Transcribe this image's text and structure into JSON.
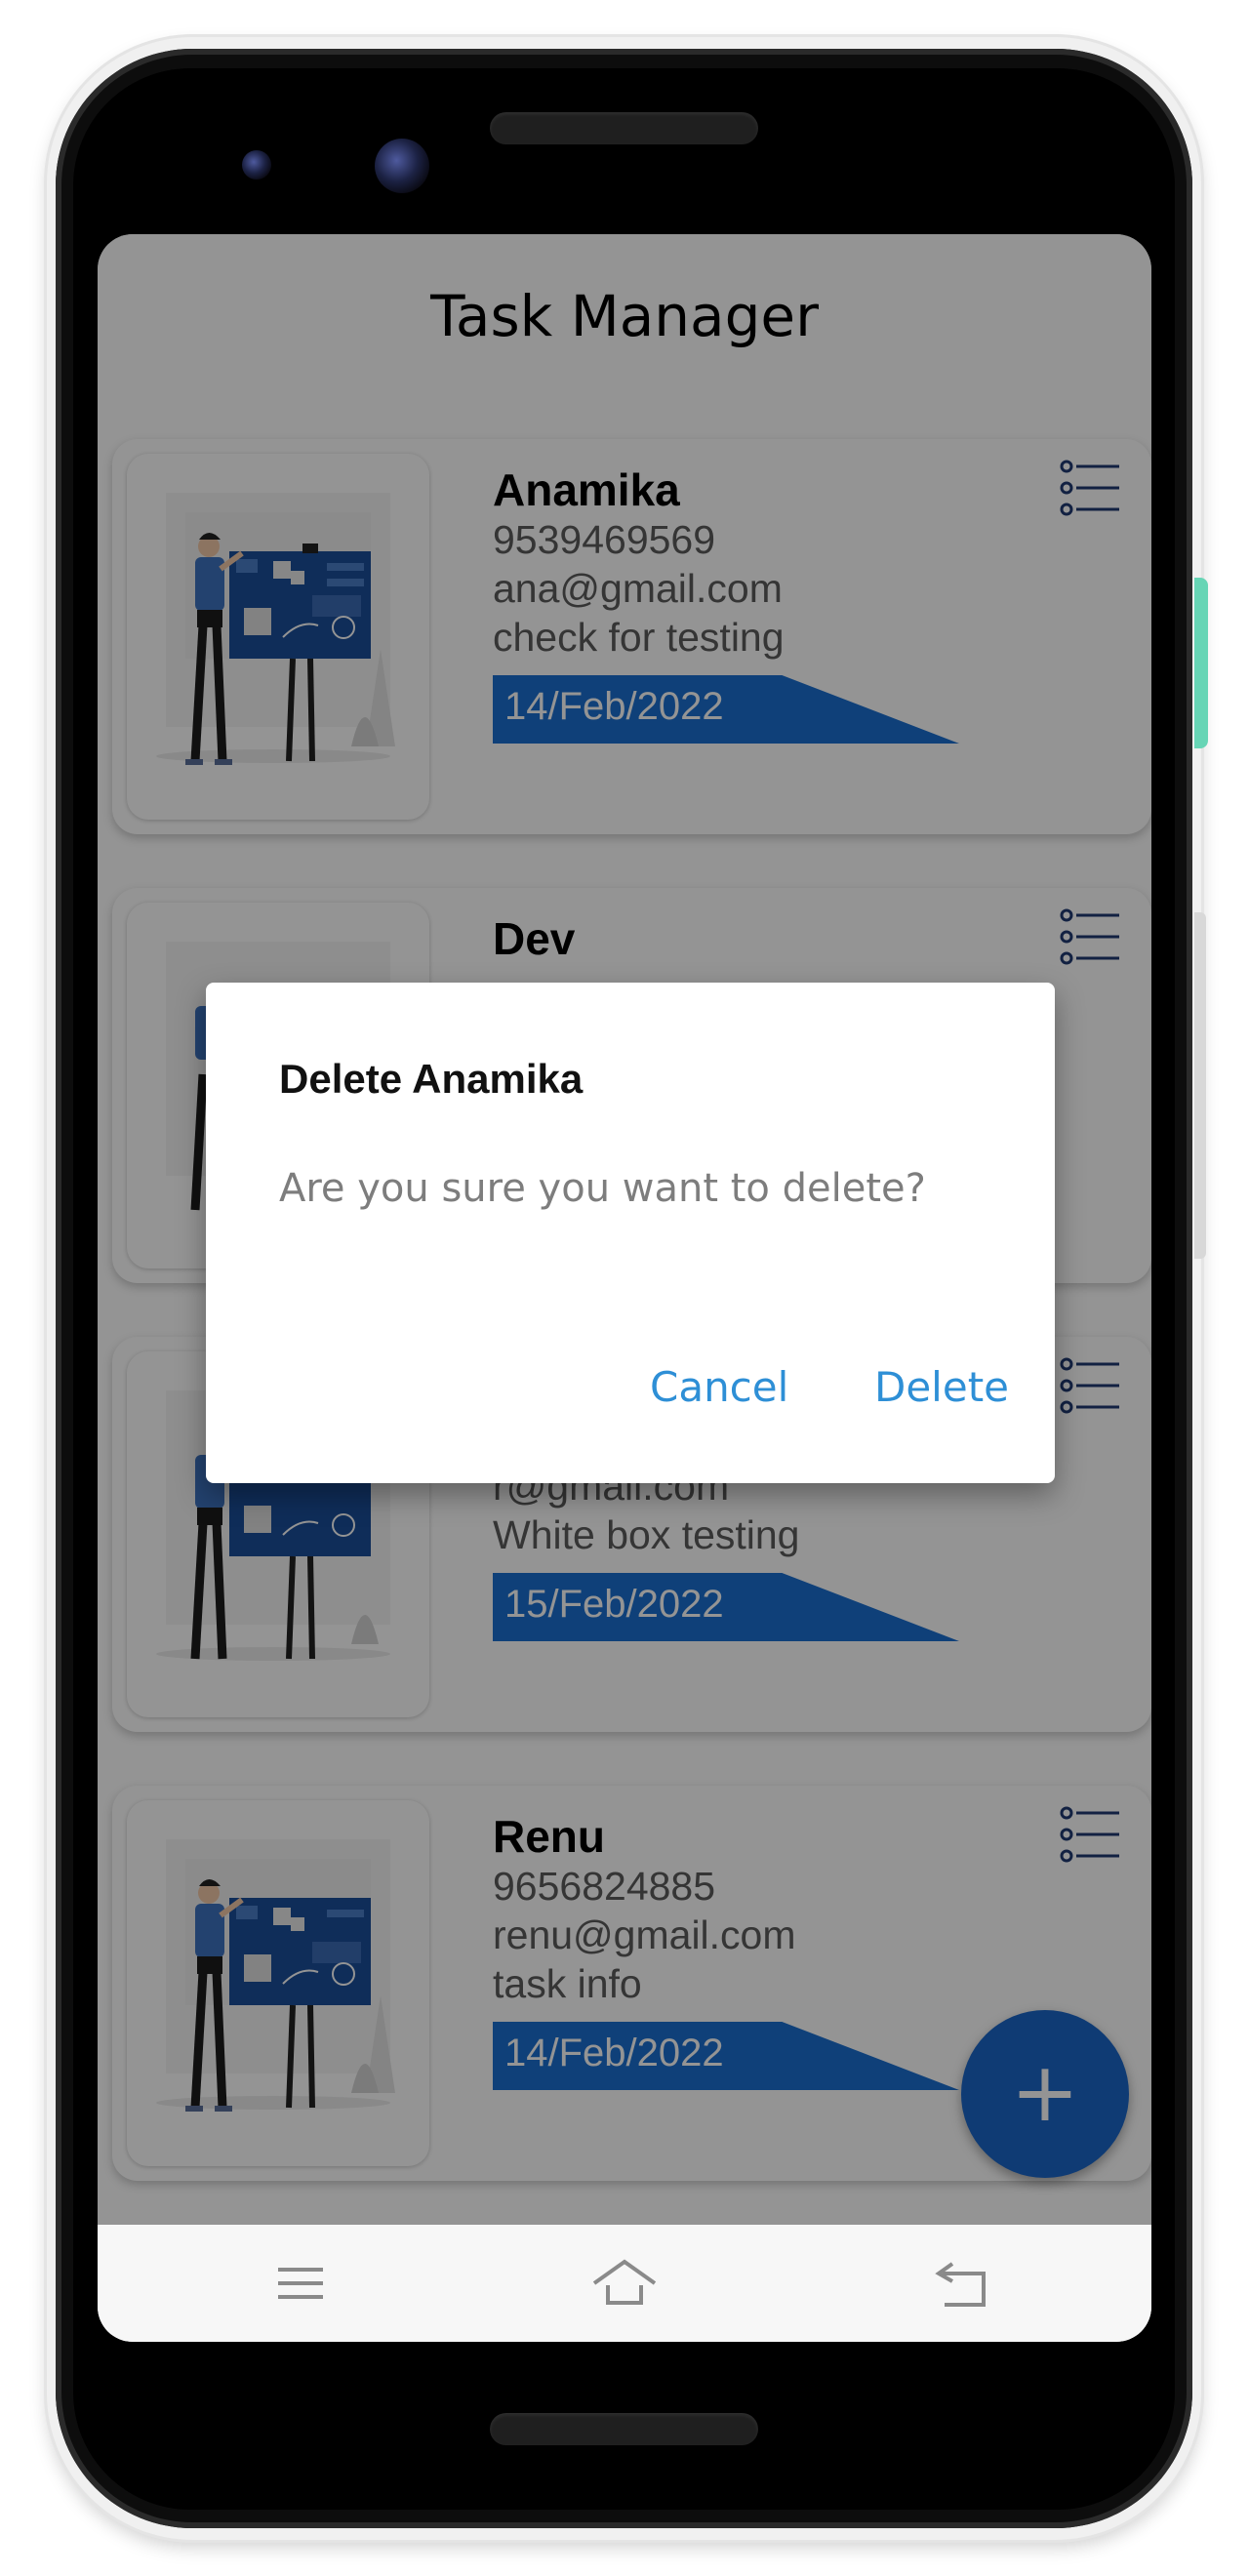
{
  "app": {
    "title": "Task Manager"
  },
  "tasks": [
    {
      "name": "Anamika",
      "phone": "9539469569",
      "email": "ana@gmail.com",
      "description": "check for testing",
      "date": "14/Feb/2022"
    },
    {
      "name": "Dev",
      "phone": "",
      "email": "",
      "description": "",
      "date": ""
    },
    {
      "name": "",
      "phone": "",
      "email": "r@gmail.com",
      "description": "White box testing",
      "date": "15/Feb/2022"
    },
    {
      "name": "Renu",
      "phone": "9656824885",
      "email": "renu@gmail.com",
      "description": "task info",
      "date": "14/Feb/2022"
    }
  ],
  "fab": {
    "label": "+"
  },
  "dialog": {
    "title": "Delete Anamika",
    "message": "Are you sure you want to delete?",
    "cancel_label": "Cancel",
    "delete_label": "Delete"
  },
  "nav": {
    "items": [
      "menu-icon",
      "home-icon",
      "back-icon"
    ]
  },
  "colors": {
    "accent_blue": "#1a6fd0",
    "fab_blue": "#1a66c8",
    "dialog_button": "#2e8fd6",
    "scrim": "rgba(0,0,0,0.42)"
  }
}
